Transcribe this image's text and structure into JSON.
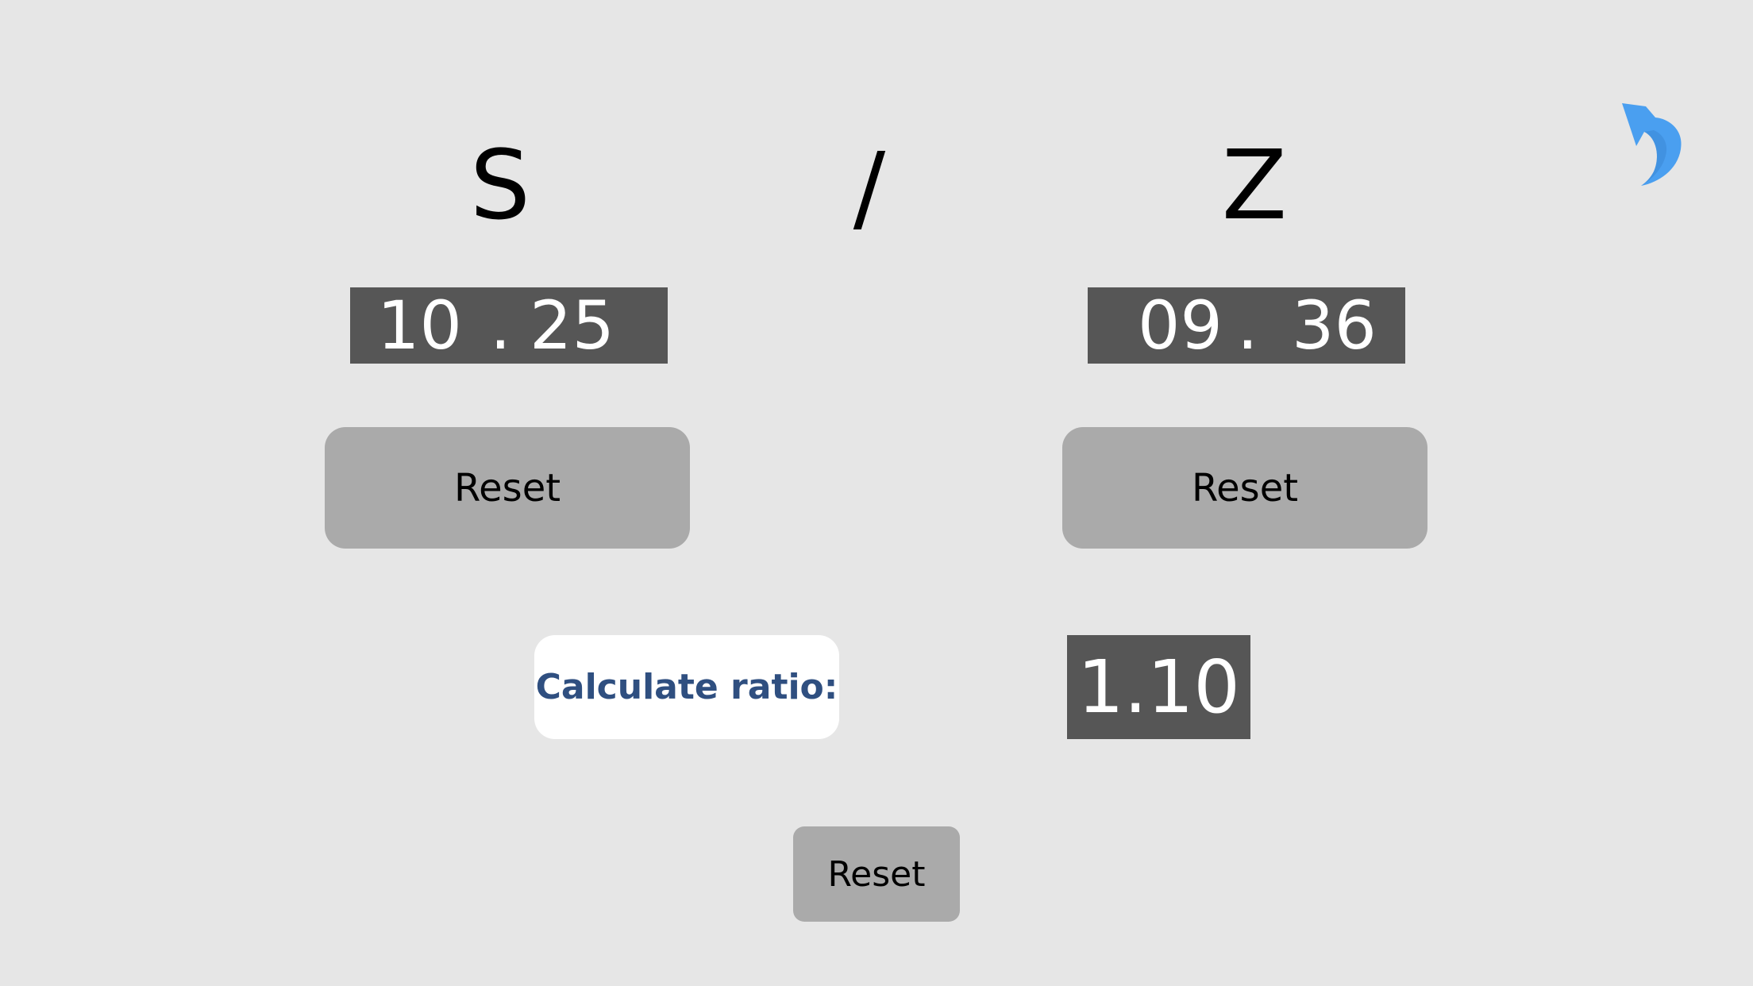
{
  "labels": {
    "left": "S",
    "separator": "/",
    "right": "Z"
  },
  "timers": {
    "s": {
      "seconds": "10",
      "dot": ".",
      "fraction": "25"
    },
    "z": {
      "seconds": "09",
      "dot": ".",
      "fraction": "36"
    }
  },
  "buttons": {
    "reset_s": "Reset",
    "reset_z": "Reset",
    "calculate": "Calculate ratio:",
    "reset_all": "Reset"
  },
  "result": {
    "ratio": "1.10"
  },
  "icons": {
    "back": "undo-arrow-icon"
  },
  "colors": {
    "background": "#e6e6e6",
    "display_bg": "#565656",
    "button_bg": "#aaaaaa",
    "calculate_text": "#2f4f80",
    "accent_icon": "#4a9ff0"
  }
}
